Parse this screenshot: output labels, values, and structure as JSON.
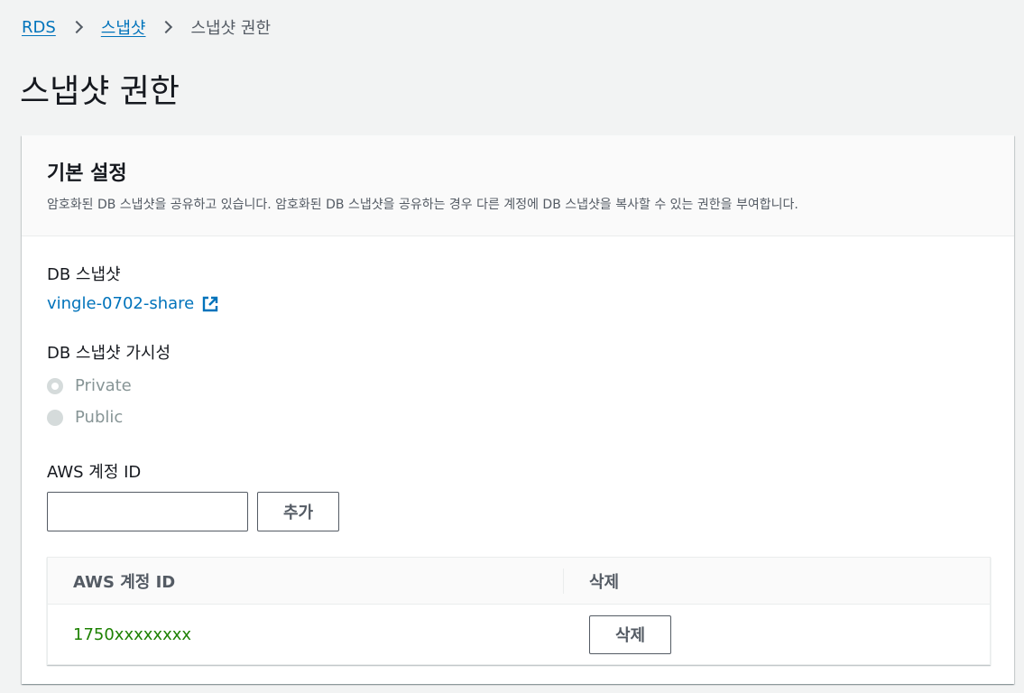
{
  "breadcrumb": {
    "items": [
      "RDS",
      "스냅샷"
    ],
    "current": "스냅샷 권한"
  },
  "page_title": "스냅샷 권한",
  "panel": {
    "title": "기본 설정",
    "description": "암호화된 DB 스냅샷을 공유하고 있습니다. 암호화된 DB 스냅샷을 공유하는 경우 다른 계정에 DB 스냅샷을 복사할 수 있는 권한을 부여합니다.",
    "snapshot_label": "DB 스냅샷",
    "snapshot_link": "vingle-0702-share",
    "visibility_label": "DB 스냅샷 가시성",
    "visibility_options": [
      "Private",
      "Public"
    ],
    "visibility_selected": "Private",
    "account_label": "AWS 계정 ID",
    "account_input_value": "",
    "add_button": "추가",
    "table": {
      "columns": [
        "AWS 계정 ID",
        "삭제"
      ],
      "rows": [
        {
          "account_id": "1750xxxxxxxx",
          "delete_label": "삭제"
        }
      ]
    }
  },
  "colors": {
    "link": "#0073bb",
    "account_id_text": "#1d8102",
    "page_bg": "#f2f3f3"
  }
}
